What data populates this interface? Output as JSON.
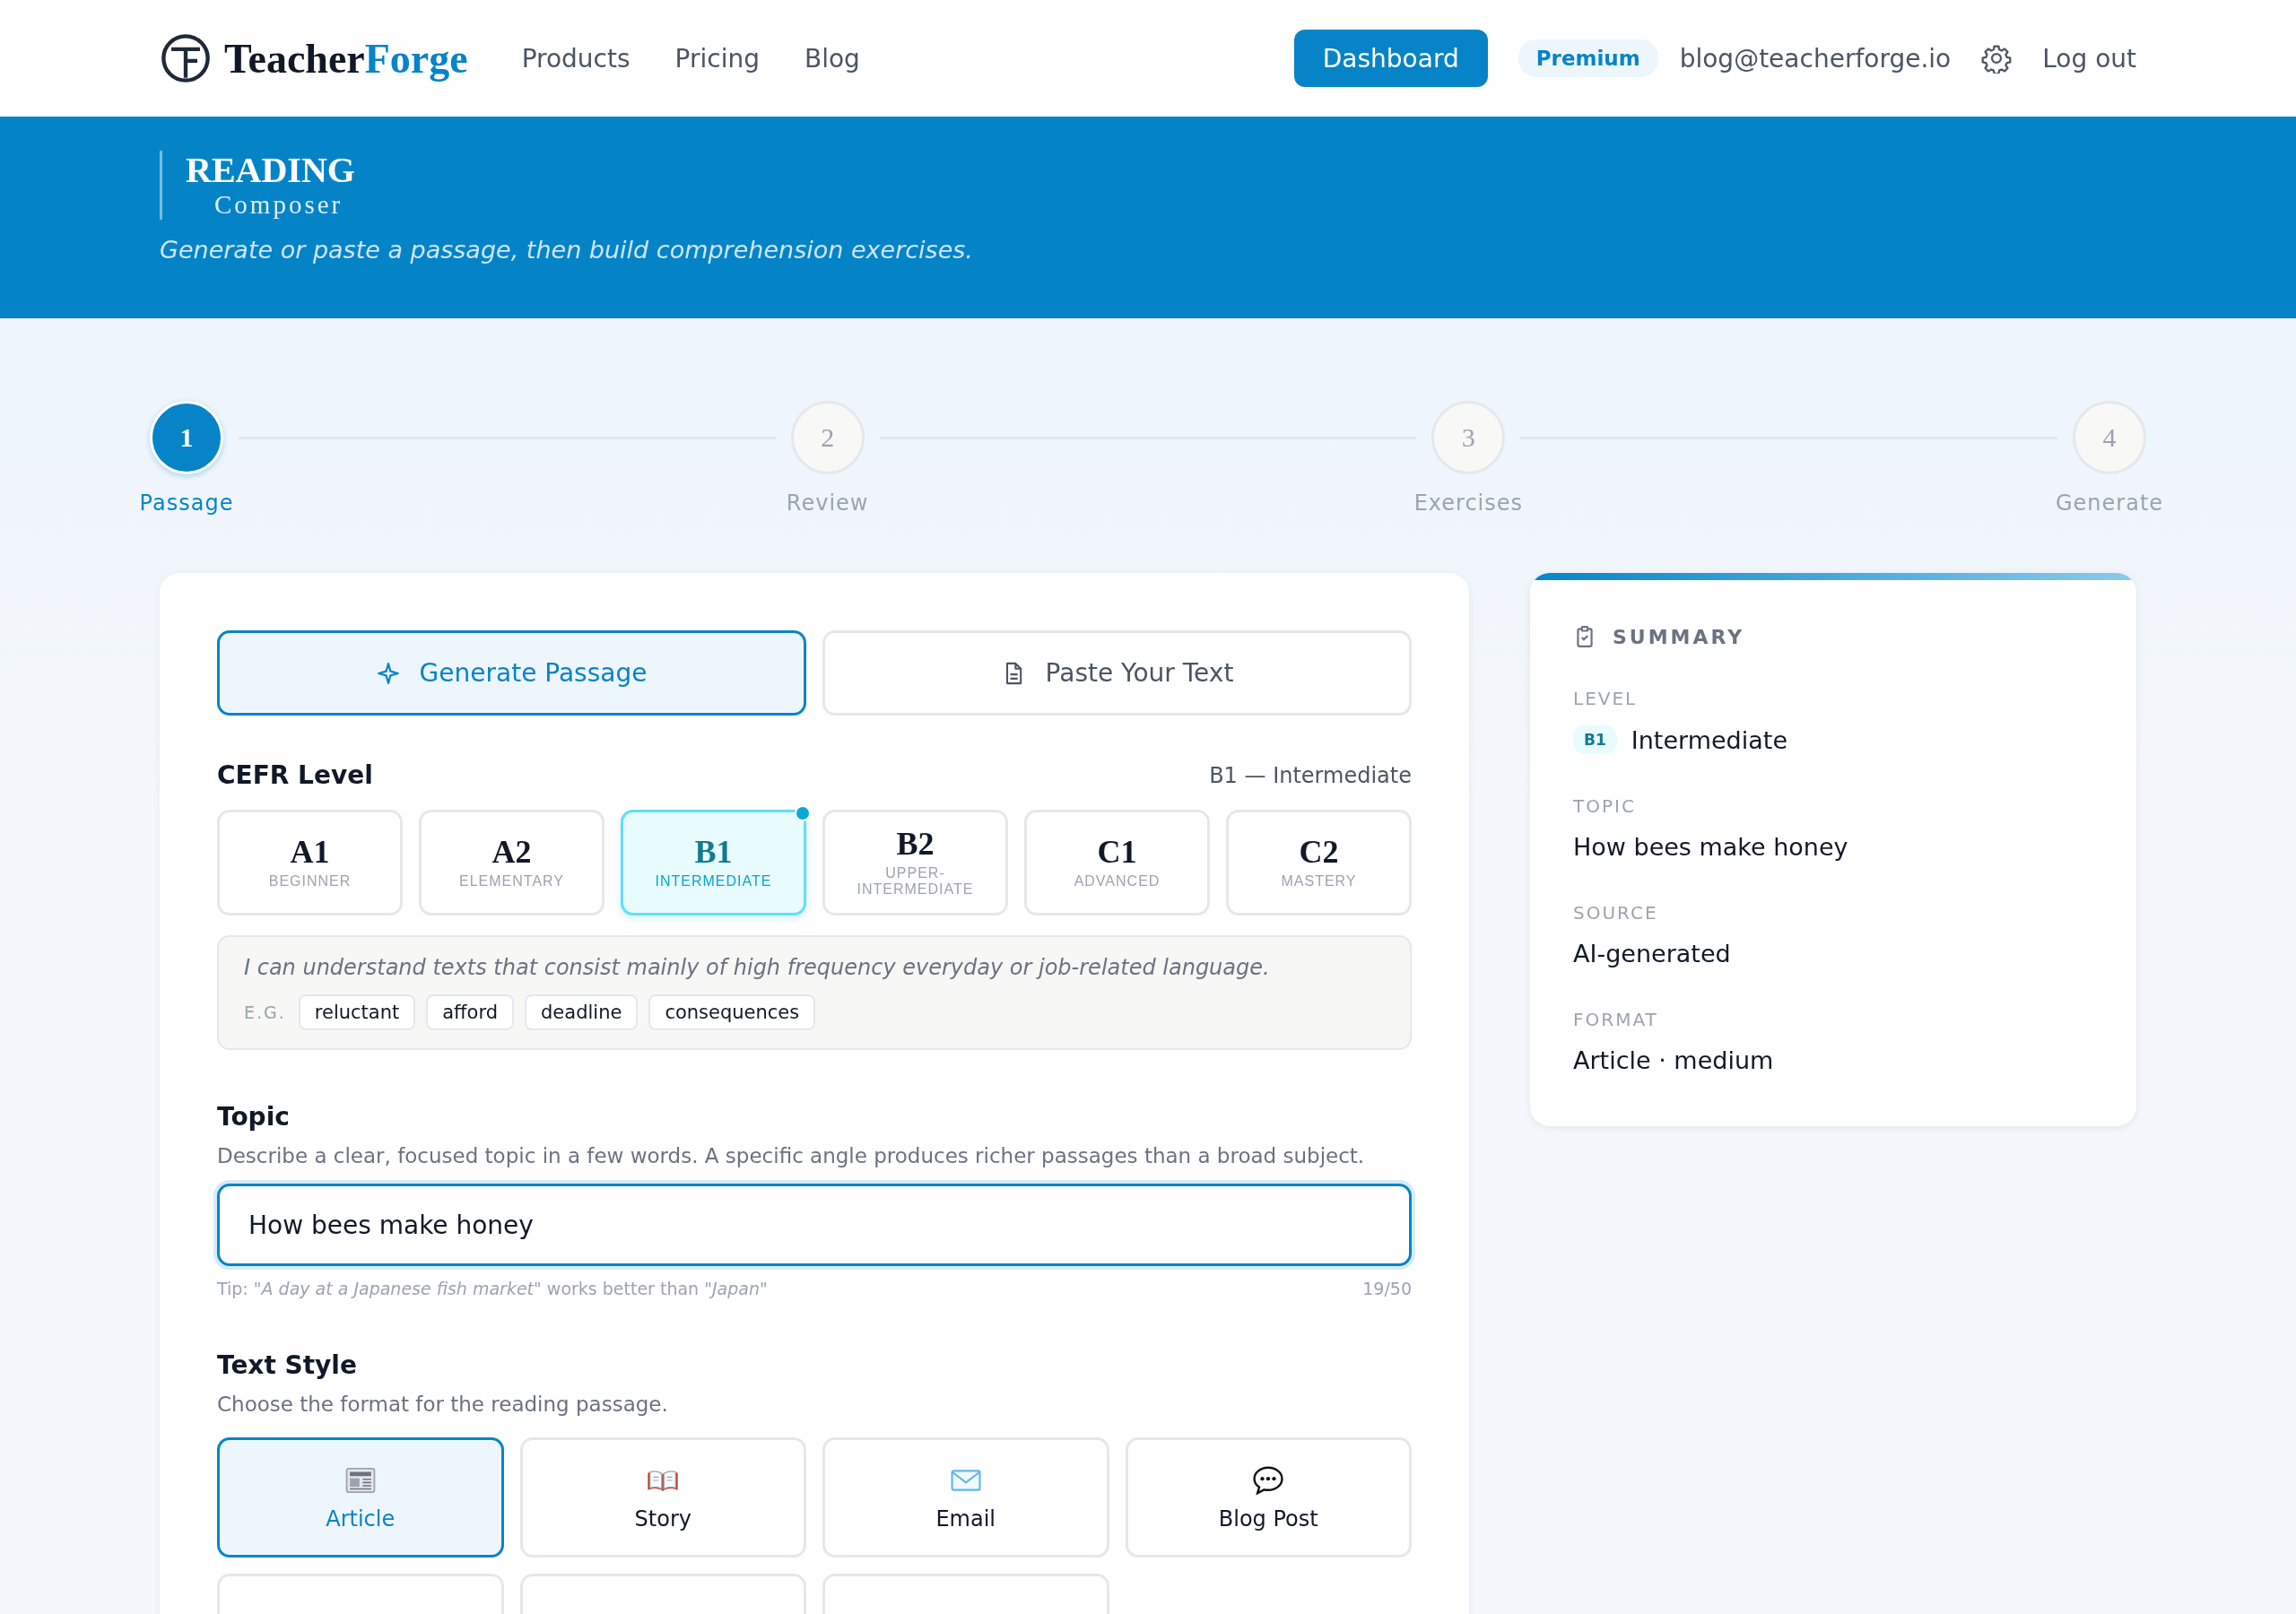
{
  "nav": {
    "logo": {
      "part_1": "Teacher",
      "part_2": "Forge"
    },
    "links": [
      {
        "label": "Products"
      },
      {
        "label": "Pricing"
      },
      {
        "label": "Blog"
      }
    ],
    "dashboard": "Dashboard",
    "badge": "Premium",
    "email": "blog@teacherforge.io",
    "logout": "Log out"
  },
  "banner": {
    "title": "READING",
    "subtitle": "Composer",
    "description": "Generate or paste a passage, then build comprehension exercises."
  },
  "steps": [
    {
      "number": "1",
      "label": "Passage",
      "selected": true
    },
    {
      "number": "2",
      "label": "Review",
      "selected": false
    },
    {
      "number": "3",
      "label": "Exercises",
      "selected": false
    },
    {
      "number": "4",
      "label": "Generate",
      "selected": false
    }
  ],
  "mode_tabs": [
    {
      "label": "Generate Passage",
      "kind": "generate",
      "selected": true
    },
    {
      "label": "Paste Your Text",
      "kind": "paste",
      "selected": false
    }
  ],
  "cefr": {
    "title": "CEFR Level",
    "current": "B1 — Intermediate",
    "levels": [
      {
        "code": "A1",
        "name": "BEGINNER",
        "selected": false
      },
      {
        "code": "A2",
        "name": "ELEMENTARY",
        "selected": false
      },
      {
        "code": "B1",
        "name": "INTERMEDIATE",
        "selected": true
      },
      {
        "code": "B2",
        "name": "UPPER-INTERMEDIATE",
        "selected": false
      },
      {
        "code": "C1",
        "name": "ADVANCED",
        "selected": false
      },
      {
        "code": "C2",
        "name": "MASTERY",
        "selected": false
      }
    ],
    "description": "I can understand texts that consist mainly of high frequency everyday or job-related language.",
    "example_label": "E.G.",
    "examples": [
      "reluctant",
      "afford",
      "deadline",
      "consequences"
    ]
  },
  "topic": {
    "title": "Topic",
    "hint": "Describe a clear, focused topic in a few words. A specific angle produces richer passages than a broad subject.",
    "value": "How bees make honey",
    "tip": "Tip: *\"A day at a Japanese fish market\"* works better than *\"Japan\"*",
    "count": "19/50"
  },
  "text_style": {
    "title": "Text Style",
    "hint": "Choose the format for the reading passage.",
    "options": [
      {
        "label": "Article",
        "kind": "article",
        "selected": true
      },
      {
        "label": "Story",
        "kind": "story",
        "selected": false
      },
      {
        "label": "Email",
        "kind": "email",
        "selected": false
      },
      {
        "label": "Blog Post",
        "kind": "blog",
        "selected": false
      },
      {
        "kind": "partial",
        "selected": false
      },
      {
        "kind": "partial",
        "selected": false
      },
      {
        "kind": "partial",
        "selected": false
      }
    ]
  },
  "summary": {
    "title": "SUMMARY",
    "fields": [
      {
        "label": "LEVEL",
        "badge": "B1",
        "value": "Intermediate"
      },
      {
        "label": "TOPIC",
        "value": "How bees make honey"
      },
      {
        "label": "SOURCE",
        "value": "AI-generated"
      },
      {
        "label": "FORMAT",
        "value": "Article · medium"
      }
    ]
  }
}
